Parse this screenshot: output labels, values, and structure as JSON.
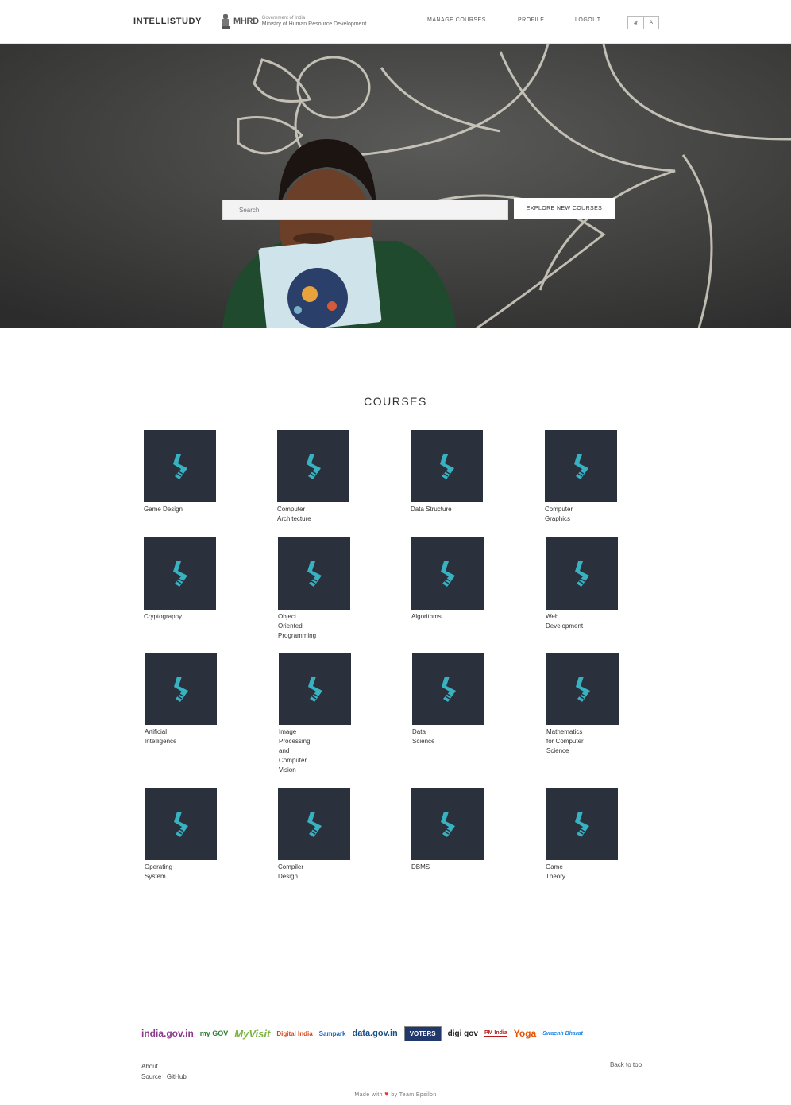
{
  "header": {
    "brand": "INTELLISTUDY",
    "mhrd_abbr": "MHRD",
    "mhrd_gov": "Government of India",
    "mhrd_full": "Ministry of Human Resource Development",
    "nav": [
      "MANAGE COURSES",
      "PROFILE",
      "LOGOUT"
    ],
    "lang": [
      "अ",
      "A"
    ]
  },
  "hero": {
    "search_placeholder": "Search",
    "search_button": "EXPLORE NEW COURSES"
  },
  "courses": {
    "title": "COURSES",
    "items": [
      "Game Design",
      "Computer Architecture",
      "Data Structure",
      "Computer Graphics",
      "Cryptography",
      "Object Oriented Programming",
      "Algorithms",
      "Web Development",
      "Artificial Intelligence",
      "Image Processing and Computer Vision",
      "Data Science",
      "Mathematics for Computer Science",
      "Operating System",
      "Compiler Design",
      "DBMS",
      "Game Theory"
    ]
  },
  "footer": {
    "partners": [
      "india.gov.in",
      "my GOV",
      "MyVisit",
      "Digital India",
      "Sampark",
      "data.gov.in",
      "VOTERS",
      "digi gov",
      "PM India",
      "Yoga",
      "Swachh Bharat"
    ],
    "about": "About",
    "source": "Source",
    "separator": "|",
    "github": "GitHub",
    "back_to_top": "Back to top",
    "made_prefix": "Made with",
    "made_suffix": "by Team Epsilon"
  },
  "colors": {
    "thumb_bg": "#2a313d",
    "logo_accent": "#38b2c1",
    "hero_board": "#3b3b3b",
    "heart": "#e53935"
  }
}
